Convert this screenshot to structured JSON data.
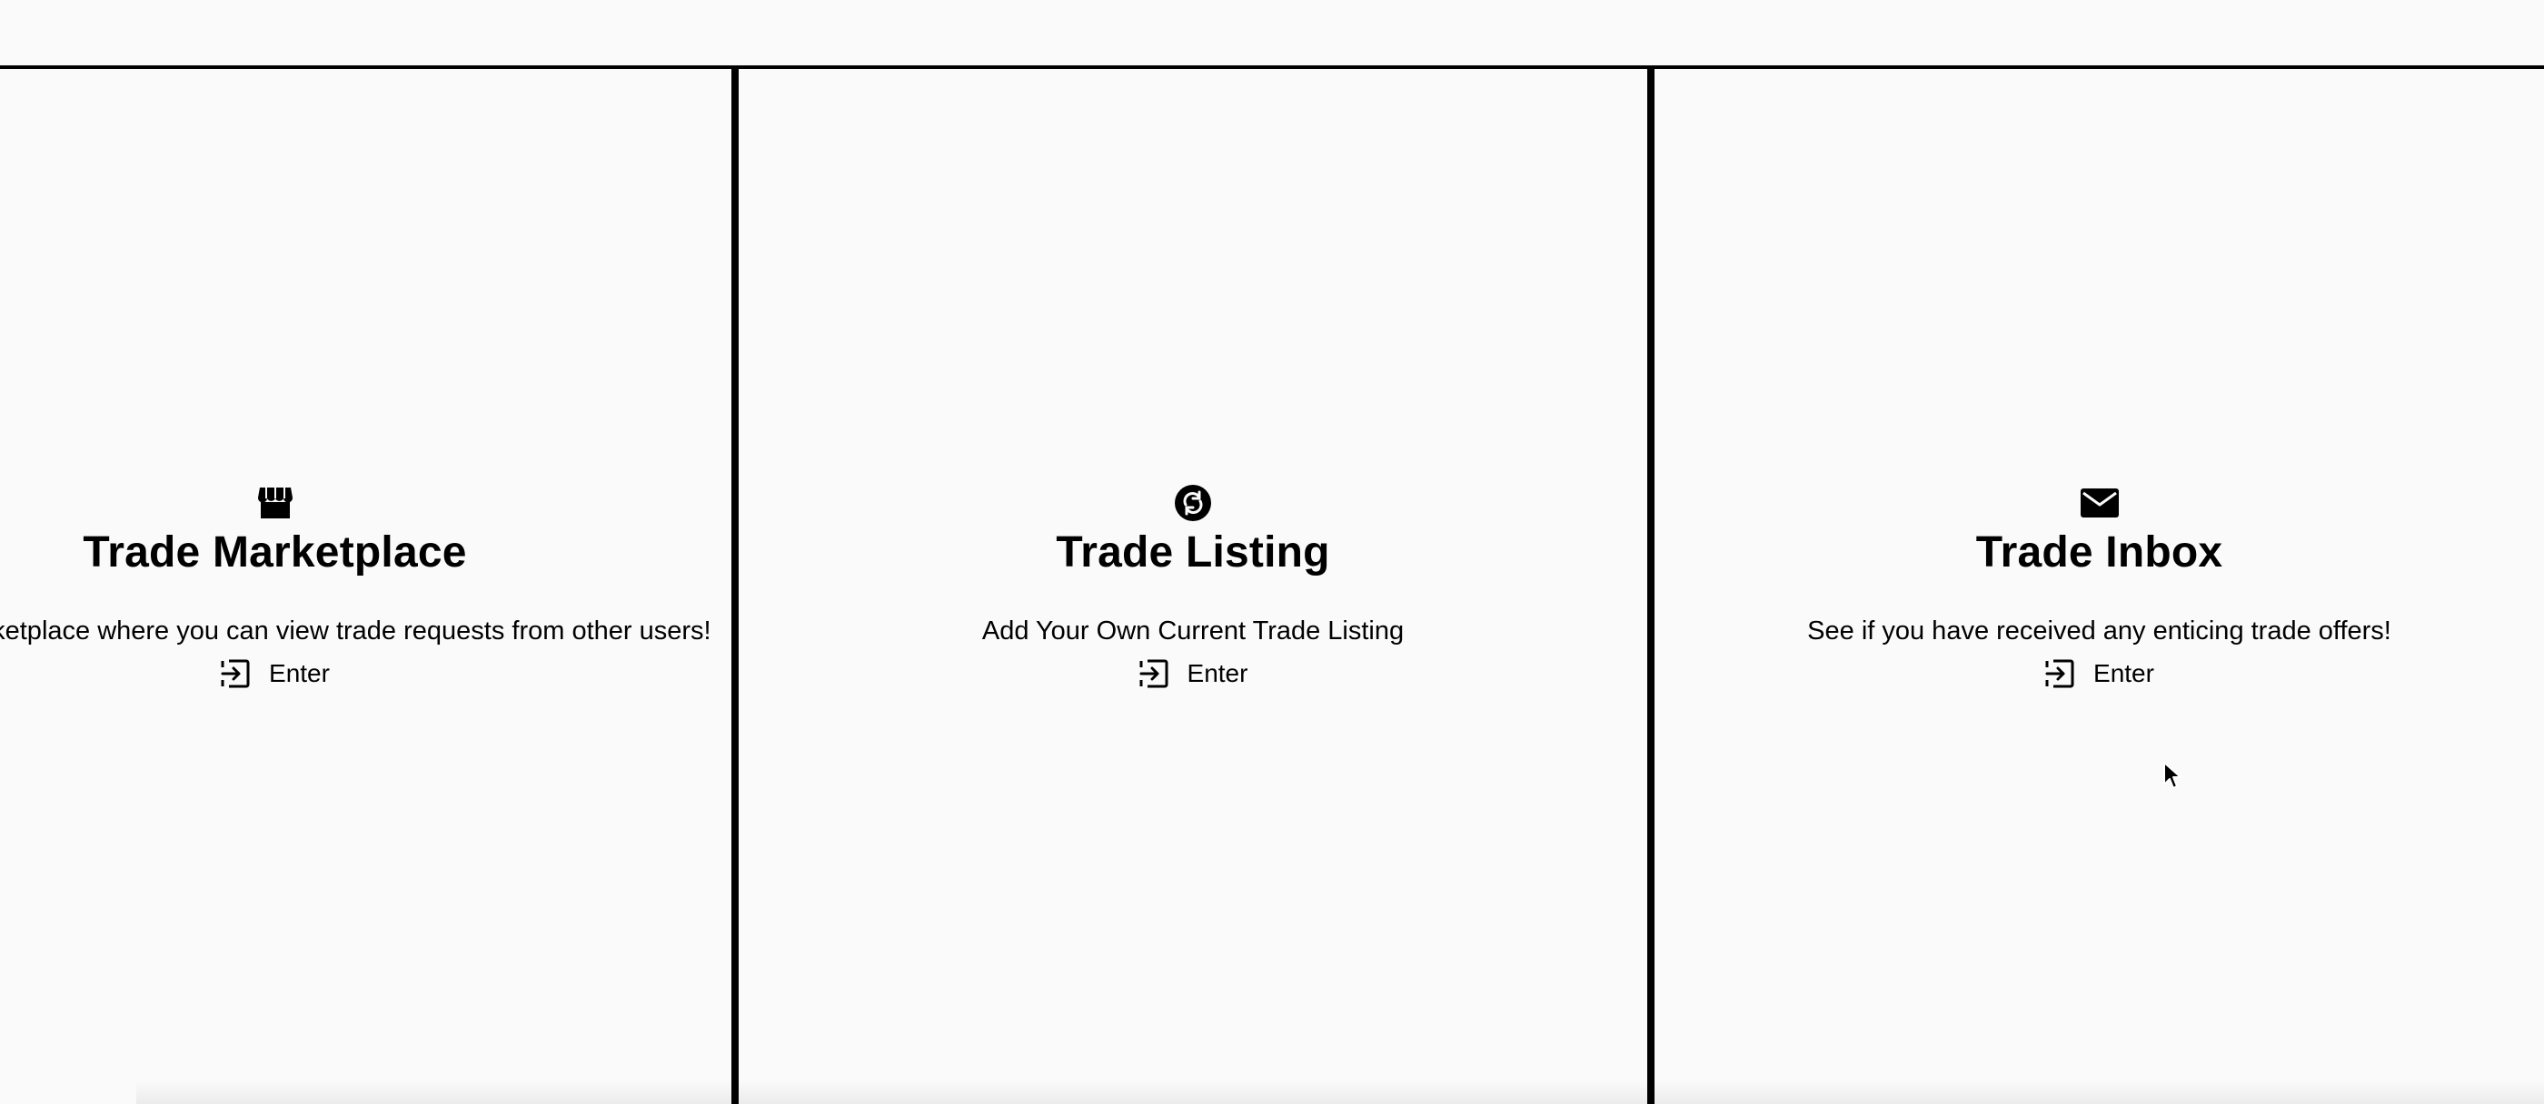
{
  "cards": [
    {
      "icon": "shop-icon",
      "title": "Trade Marketplace",
      "description": "View the marketplace where you can view trade requests from other users!",
      "action_label": "Enter",
      "action_icon": "enter-icon"
    },
    {
      "icon": "swap-cycle-icon",
      "title": "Trade Listing",
      "description": "Add Your Own Current Trade Listing",
      "action_label": "Enter",
      "action_icon": "enter-icon"
    },
    {
      "icon": "envelope-icon",
      "title": "Trade Inbox",
      "description": "See if you have received any enticing trade offers!",
      "action_label": "Enter",
      "action_icon": "enter-icon"
    }
  ],
  "colors": {
    "background": "#fafafa",
    "text": "#000000",
    "divider": "#000000"
  },
  "cursor_icon": "mouse-pointer-icon"
}
